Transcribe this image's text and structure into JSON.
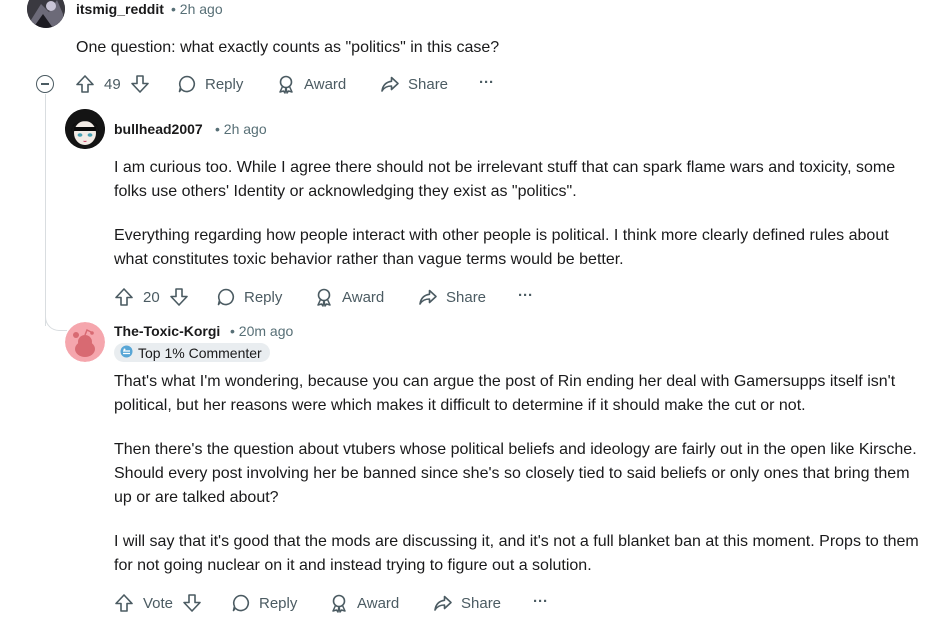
{
  "comments": [
    {
      "author": "itsmig_reddit",
      "time": "2h ago",
      "paragraphs": [
        "One question: what exactly counts as \"politics\" in this case?"
      ],
      "score": "49"
    },
    {
      "author": "bullhead2007",
      "time": "2h ago",
      "paragraphs": [
        "I am curious too. While I agree there should not be irrelevant stuff that can spark flame wars and toxicity, some folks use others' Identity or acknowledging they exist as \"politics\".",
        "Everything regarding how people interact with other people is political. I think more clearly defined rules about what constitutes toxic behavior rather than vague terms would be better."
      ],
      "score": "20"
    },
    {
      "author": "The-Toxic-Korgi",
      "time": "20m ago",
      "badge": "Top 1% Commenter",
      "paragraphs": [
        "That's what I'm wondering, because you can argue the post of Rin ending her deal with Gamersupps itself isn't political, but her reasons were which makes it difficult to determine if it should make the cut or not.",
        "Then there's the question about vtubers whose political beliefs and ideology are fairly out in the open like Kirsche. Should every post involving her be banned since she's so closely tied to said beliefs or only ones that bring them up or are talked about?",
        "I will say that it's good that the mods are discussing it, and it's not a full blanket ban at this moment. Props to them for not going nuclear on it and instead trying to figure out a solution."
      ],
      "score": "Vote"
    }
  ],
  "actions": {
    "reply": "Reply",
    "award": "Award",
    "share": "Share",
    "more": "···",
    "separator": "•"
  },
  "icons": {
    "upvote": "arrow-up-icon",
    "downvote": "arrow-down-icon",
    "reply": "speech-bubble-icon",
    "award": "award-icon",
    "share": "share-arrow-icon",
    "more": "ellipsis-icon",
    "collapse": "collapse-minus-icon",
    "badge": "commenter-badge-icon"
  },
  "colors": {
    "text": "#1a1a1b",
    "meta": "#576f76",
    "action": "#4b5b62",
    "thread_line": "#d9dde0",
    "badge_bg": "#e9edf0",
    "korgi_avatar_bg": "#f5a6ad"
  }
}
